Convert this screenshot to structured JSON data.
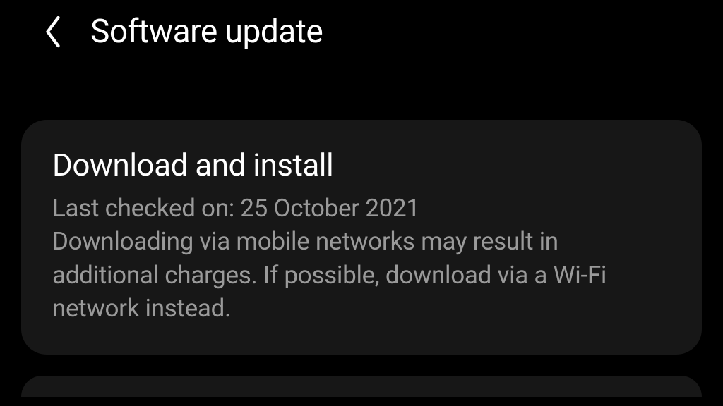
{
  "header": {
    "title": "Software update"
  },
  "card": {
    "title": "Download and install",
    "subtitle_line1": "Last checked on: 25 October 2021",
    "subtitle_line2": "Downloading via mobile networks may result in additional charges. If possible, download via a Wi-Fi network instead."
  }
}
